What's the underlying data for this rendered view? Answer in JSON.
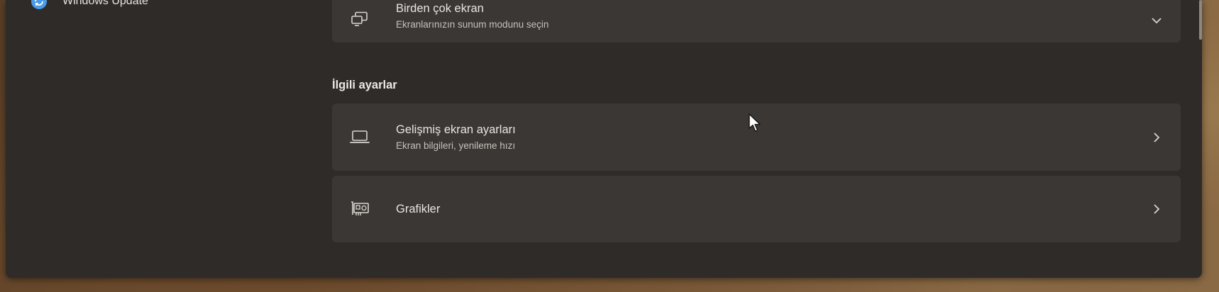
{
  "sidebar": {
    "items": [
      {
        "label": "Windows Update",
        "icon": "windows-update-icon"
      }
    ]
  },
  "main": {
    "multiple_displays": {
      "title": "Birden çok ekran",
      "subtitle": "Ekranlarınızın sunum modunu seçin",
      "icon": "multiple-displays-icon",
      "control": "chevron-down-icon"
    },
    "related_settings": {
      "heading": "İlgili ayarlar",
      "items": [
        {
          "title": "Gelişmiş ekran ayarları",
          "subtitle": "Ekran bilgileri, yenileme hızı",
          "icon": "laptop-icon",
          "control": "chevron-right-icon"
        },
        {
          "title": "Grafikler",
          "icon": "graphics-card-icon",
          "control": "chevron-right-icon"
        }
      ]
    }
  },
  "colors": {
    "window_bg": "#2f2b28",
    "card_bg": "#3b3734",
    "accent": "#4a9be8"
  }
}
